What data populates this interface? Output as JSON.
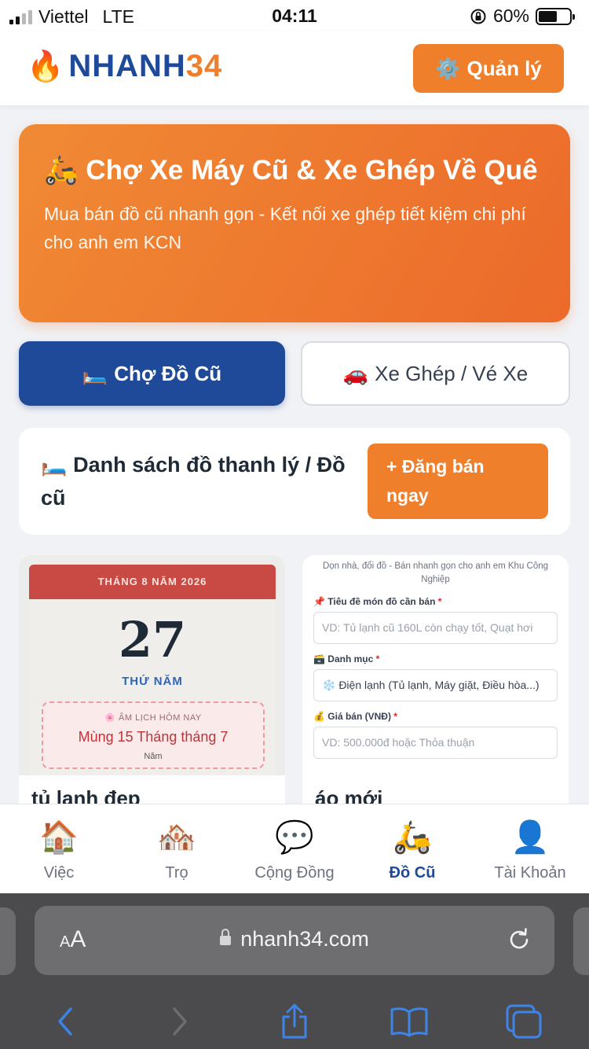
{
  "status_bar": {
    "carrier": "Viettel",
    "network": "LTE",
    "time": "04:11",
    "battery_percent": "60%",
    "battery_level": 0.6
  },
  "header": {
    "logo_primary": "NHANH",
    "logo_accent": "34",
    "manage_label": "Quản lý"
  },
  "hero": {
    "title": "🛵 Chợ Xe Máy Cũ & Xe Ghép Về Quê",
    "subtitle": "Mua bán đồ cũ nhanh gọn - Kết nối xe ghép tiết kiệm chi phí cho anh em KCN"
  },
  "tabs": [
    {
      "icon": "🛏️",
      "label": "Chợ Đồ Cũ",
      "active": true
    },
    {
      "icon": "🚗",
      "label": "Xe Ghép / Vé Xe",
      "active": false
    }
  ],
  "section": {
    "title": "🛏️ Danh sách đồ thanh lý / Đồ cũ",
    "post_button": "+ Đăng bán ngay"
  },
  "listings": [
    {
      "title": "tủ lạnh đẹp",
      "calendar": {
        "month_year": "THÁNG 8 NĂM 2026",
        "day": "27",
        "weekday": "THỨ NĂM",
        "lunar_header": "🌸 ÂM LỊCH HÔM NAY",
        "lunar_date": "Mùng 15 Tháng tháng 7",
        "lunar_year": "Năm"
      }
    },
    {
      "title": "áo mới",
      "form": {
        "intro": "Dọn nhà, đổi đồ - Bán nhanh gọn cho anh em Khu Công Nghiệp",
        "title_label": "📌 Tiêu đề món đồ cần bán",
        "title_placeholder": "VD: Tủ lạnh cũ 160L còn chạy tốt, Quạt hơi",
        "category_label": "🗃️ Danh mục",
        "category_value": "❄️ Điện lạnh (Tủ lạnh, Máy giặt, Điều hòa...)",
        "price_label": "💰 Giá bán (VNĐ)",
        "price_placeholder": "VD: 500.000đ hoặc Thỏa thuận",
        "required_mark": "*"
      }
    }
  ],
  "bottom_nav": [
    {
      "icon": "🏠",
      "label": "Việc",
      "active": false
    },
    {
      "icon": "🏘️",
      "label": "Trọ",
      "active": false
    },
    {
      "icon": "💬",
      "label": "Cộng Đồng",
      "active": false
    },
    {
      "icon": "🛵",
      "label": "Đồ Cũ",
      "active": true
    },
    {
      "icon": "👤",
      "label": "Tài Khoản",
      "active": false
    }
  ],
  "browser": {
    "text_size_small": "A",
    "text_size_big": "A",
    "url": "nhanh34.com"
  },
  "colors": {
    "brand_blue": "#1e4a99",
    "brand_orange": "#ef7f2a",
    "safari_blue": "#3d84e6"
  }
}
